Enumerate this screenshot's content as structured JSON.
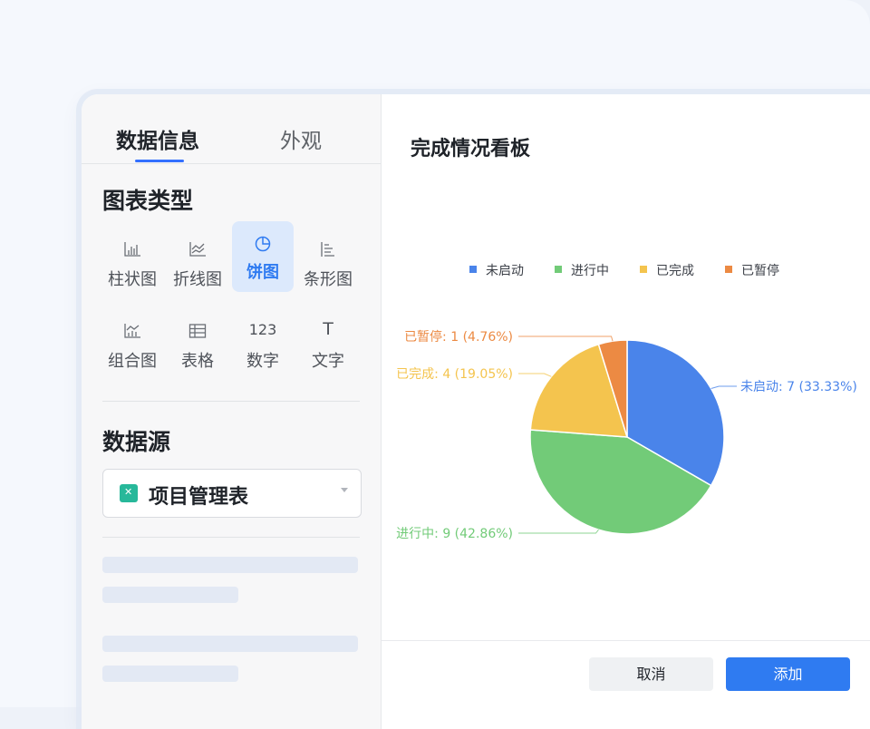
{
  "tabs": {
    "data_info": "数据信息",
    "appearance": "外观"
  },
  "sections": {
    "chart_type": "图表类型",
    "data_source": "数据源"
  },
  "chart_types": [
    {
      "label": "柱状图",
      "icon": "bar-chart-icon",
      "active": false
    },
    {
      "label": "折线图",
      "icon": "line-chart-icon",
      "active": false
    },
    {
      "label": "饼图",
      "icon": "pie-chart-icon",
      "active": true
    },
    {
      "label": "条形图",
      "icon": "horizontal-bar-icon",
      "active": false
    },
    {
      "label": "组合图",
      "icon": "combo-chart-icon",
      "active": false
    },
    {
      "label": "表格",
      "icon": "table-icon",
      "active": false
    },
    {
      "label": "数字",
      "icon": "number-icon",
      "icon_text": "123",
      "active": false
    },
    {
      "label": "文字",
      "icon": "text-icon",
      "icon_text": "T",
      "active": false
    }
  ],
  "data_source": {
    "value": "项目管理表",
    "icon": "sheet-icon"
  },
  "preview": {
    "title": "完成情况看板"
  },
  "buttons": {
    "cancel": "取消",
    "add": "添加"
  },
  "colors": {
    "accent": "#2f7bf1",
    "not_started": "#4a84ea",
    "in_progress": "#72cb78",
    "completed": "#f4c44e",
    "paused": "#ec8a43"
  },
  "chart_data": {
    "type": "pie",
    "title": "完成情况看板",
    "legend_position": "top-center",
    "slices": [
      {
        "label": "未启动",
        "value": 7,
        "percent": "33.33%",
        "color": "#4a84ea",
        "text": "未启动: 7 (33.33%)"
      },
      {
        "label": "进行中",
        "value": 9,
        "percent": "42.86%",
        "color": "#72cb78",
        "text": "进行中: 9 (42.86%)"
      },
      {
        "label": "已完成",
        "value": 4,
        "percent": "19.05%",
        "color": "#f4c44e",
        "text": "已完成: 4 (19.05%)"
      },
      {
        "label": "已暂停",
        "value": 1,
        "percent": "4.76%",
        "color": "#ec8a43",
        "text": "已暂停: 1 (4.76%)"
      }
    ]
  }
}
